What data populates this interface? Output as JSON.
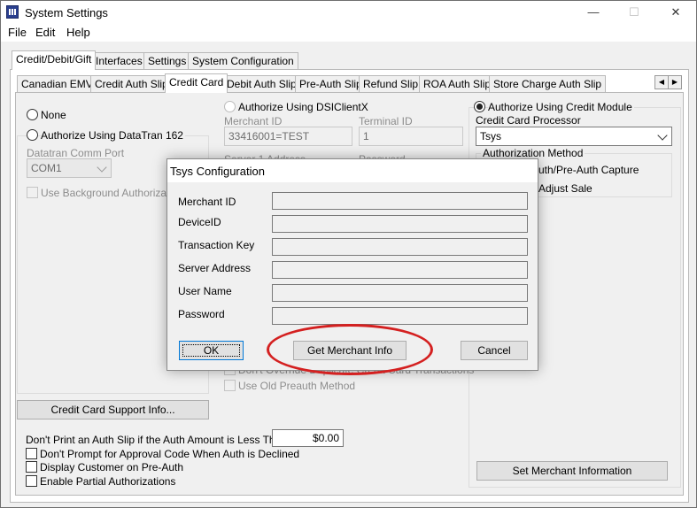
{
  "window": {
    "title": "System Settings",
    "minimize": "—",
    "maximize": "☐",
    "close": "✕"
  },
  "menu": [
    "File",
    "Edit",
    "Help"
  ],
  "outer_tabs": [
    "Credit/Debit/Gift",
    "Interfaces",
    "Settings",
    "System Configuration"
  ],
  "inner_tabs": [
    "Canadian EMV",
    "Credit Auth Slip",
    "Credit Card",
    "Debit Auth Slip",
    "Pre-Auth Slip",
    "Refund Slip",
    "ROA Auth Slip",
    "Store Charge Auth Slip"
  ],
  "left": {
    "none_label": "None",
    "datatran_label": "Authorize Using DataTran 162",
    "comm_port_label": "Datatran Comm Port",
    "comm_port_value": "COM1",
    "background_auth_label": "Use Background Authorization",
    "support_button": "Credit Card Support Info...",
    "min_amount_label": "Don't Print an Auth Slip if the Auth Amount is Less Than",
    "min_amount_value": "$0.00",
    "no_prompt_label": "Don't Prompt for Approval Code When Auth is Declined",
    "display_customer_label": "Display Customer on Pre-Auth",
    "partial_auth_label": "Enable Partial Authorizations"
  },
  "middle": {
    "dsi_label": "Authorize Using DSIClientX",
    "merchant_id_label": "Merchant ID",
    "merchant_id_value": "33416001=TEST",
    "terminal_id_label": "Terminal ID",
    "terminal_id_value": "1",
    "server_address_label": "Server 1 Address",
    "password_label": "Password",
    "override_dup_label": "Don't Override Duplicate Credit Card Transactions",
    "old_preauth_label": "Use Old Preauth Method"
  },
  "right": {
    "credit_module_label": "Authorize Using Credit Module",
    "processor_label": "Credit Card Processor",
    "processor_value": "Tsys",
    "auth_method_label": "Authorization Method",
    "auth_option1": "Auth/Pre-Auth Capture",
    "auth_option2": "Adjust Sale",
    "set_merchant_button": "Set Merchant Information"
  },
  "dialog": {
    "title": "Tsys Configuration",
    "fields": [
      {
        "label": "Merchant ID",
        "value": ""
      },
      {
        "label": "DeviceID",
        "value": ""
      },
      {
        "label": "Transaction Key",
        "value": ""
      },
      {
        "label": "Server Address",
        "value": ""
      },
      {
        "label": "User Name",
        "value": ""
      },
      {
        "label": "Password",
        "value": ""
      }
    ],
    "ok_button": "OK",
    "get_merchant_button": "Get Merchant Info",
    "cancel_button": "Cancel"
  },
  "colors": {
    "annotation": "#d42020",
    "focus": "#0078d7"
  }
}
